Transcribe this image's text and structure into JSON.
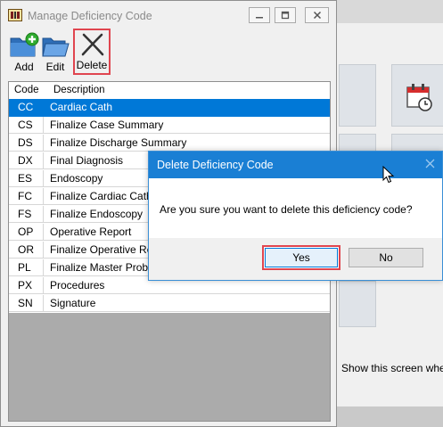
{
  "background": {
    "show_screen_label": "Show this screen when l"
  },
  "manage_window": {
    "title": "Manage Deficiency Code",
    "toolbar": {
      "add_label": "Add",
      "edit_label": "Edit",
      "delete_label": "Delete"
    },
    "grid": {
      "columns": [
        "Code",
        "Description"
      ],
      "selected_code": "CC",
      "rows": [
        {
          "code": "CC",
          "description": "Cardiac Cath"
        },
        {
          "code": "CS",
          "description": "Finalize Case Summary"
        },
        {
          "code": "DS",
          "description": "Finalize Discharge Summary"
        },
        {
          "code": "DX",
          "description": "Final Diagnosis"
        },
        {
          "code": "ES",
          "description": "Endoscopy"
        },
        {
          "code": "FC",
          "description": "Finalize Cardiac Cath"
        },
        {
          "code": "FS",
          "description": "Finalize Endoscopy"
        },
        {
          "code": "OP",
          "description": "Operative Report"
        },
        {
          "code": "OR",
          "description": "Finalize Operative Report"
        },
        {
          "code": "PL",
          "description": "Finalize Master Problem List"
        },
        {
          "code": "PX",
          "description": "Procedures"
        },
        {
          "code": "SN",
          "description": "Signature"
        }
      ]
    }
  },
  "dialog": {
    "title": "Delete Deficiency Code",
    "message": "Are you sure you want to delete this deficiency code?",
    "yes_label": "Yes",
    "no_label": "No"
  },
  "colors": {
    "selection": "#0078d7",
    "dialog_title_bar": "#1a7fd4",
    "highlight_box": "#e0454f"
  },
  "icons": [
    "app-icon",
    "add-folder-icon",
    "open-folder-icon",
    "delete-x-icon",
    "calendar-clock-icon",
    "mouse-cursor-icon"
  ]
}
